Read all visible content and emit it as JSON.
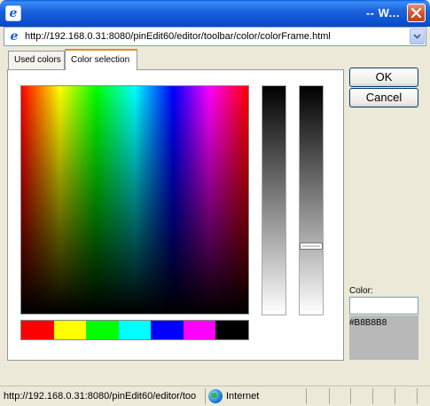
{
  "window": {
    "title": "-- W...",
    "app_icon": "ie-icon"
  },
  "address": {
    "url": "http://192.168.0.31:8080/pinEdit60/editor/toolbar/color/colorFrame.html"
  },
  "tabs": [
    {
      "label": "Used colors",
      "active": false
    },
    {
      "label": "Color selection",
      "active": true
    }
  ],
  "buttons": {
    "ok_label": "OK",
    "cancel_label": "Cancel"
  },
  "color": {
    "label": "Color:",
    "input_value": "",
    "hex": "#B8B8B8",
    "preview_color": "#b8b8b8"
  },
  "swatches": [
    "#ff0000",
    "#ffff00",
    "#00ff00",
    "#00ffff",
    "#0000ff",
    "#ff00ff",
    "#000000"
  ],
  "slider": {
    "level": 0.7
  },
  "status": {
    "url": "http://192.168.0.31:8080/pinEdit60/editor/too",
    "zone": "Internet",
    "zone_icon": "globe-icon"
  }
}
